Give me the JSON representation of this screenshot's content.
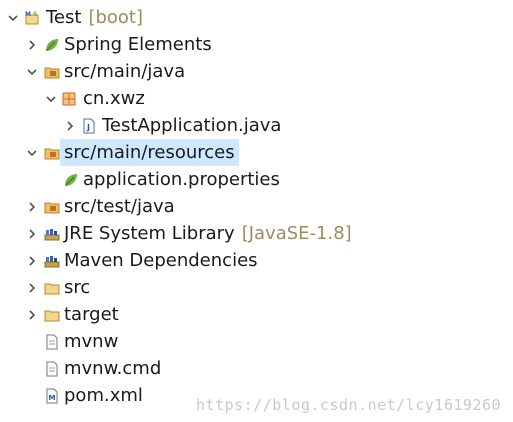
{
  "project_explorer": {
    "project": {
      "label": "Test",
      "decoration": "[boot]"
    },
    "items": {
      "spring_elements": {
        "label": "Spring Elements"
      },
      "src_main_java": {
        "label": "src/main/java"
      },
      "cn_xwz": {
        "label": "cn.xwz"
      },
      "test_application": {
        "label": "TestApplication.java"
      },
      "src_main_resources": {
        "label": "src/main/resources"
      },
      "application_properties": {
        "label": "application.properties"
      },
      "src_test_java": {
        "label": "src/test/java"
      },
      "jre_system_library": {
        "label": "JRE System Library",
        "decoration": "[JavaSE-1.8]"
      },
      "maven_dependencies": {
        "label": "Maven Dependencies"
      },
      "src": {
        "label": "src"
      },
      "target": {
        "label": "target"
      },
      "mvnw": {
        "label": "mvnw"
      },
      "mvnw_cmd": {
        "label": "mvnw.cmd"
      },
      "pom_xml": {
        "label": "pom.xml"
      }
    },
    "selected_item": "src/main/resources"
  },
  "watermark": "https://blog.csdn.net/lcy1619260",
  "colors": {
    "selection": "#cde8ff",
    "decoration_text": "#9c8b61",
    "spring_leaf": "#6db33f",
    "package_folder": "#c8a24a",
    "package_orange": "#c86a2a"
  }
}
